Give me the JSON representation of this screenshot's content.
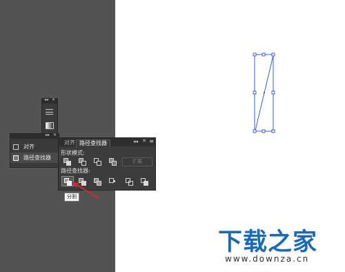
{
  "dock": {
    "panel1_items": [
      {
        "icon": "align-icon",
        "label": "对齐"
      },
      {
        "icon": "pathfinder-icon",
        "label": "路径查找器"
      }
    ]
  },
  "pathfinder": {
    "tabs": [
      "对齐",
      "路径查找器"
    ],
    "active_tab": "路径查找器",
    "shape_modes_label": "形状模式:",
    "pathfinders_label": "路径查找器:",
    "expand_label": "扩展",
    "shape_mode_buttons": [
      "unite-icon",
      "minus-front-icon",
      "intersect-icon",
      "exclude-icon"
    ],
    "pathfinder_buttons": [
      "divide-icon",
      "trim-icon",
      "merge-icon",
      "crop-icon",
      "outline-icon",
      "minus-back-icon"
    ],
    "tooltip": "分割"
  },
  "colors": {
    "workspace": "#535353",
    "panel": "#3c3c3c",
    "selection": "#3b5bd4",
    "arrow": "#d9262c",
    "watermark": "#1a6ab8"
  },
  "watermark": {
    "title": "下载之家",
    "url": "www.downza.cn"
  }
}
